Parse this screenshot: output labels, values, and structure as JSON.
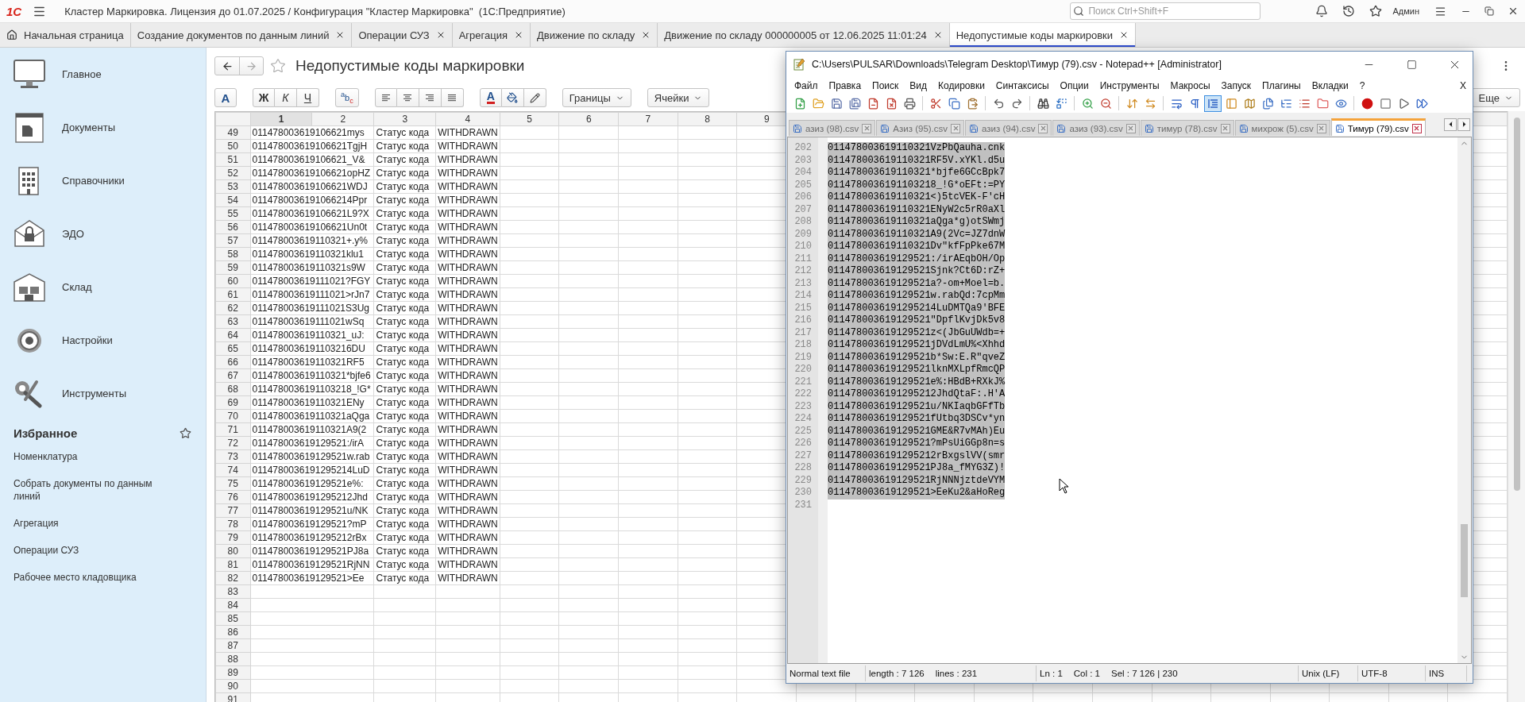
{
  "title_bar": {
    "logo": "1С",
    "title": "Кластер Маркировка. Лицензия до 01.07.2025 / Конфигурация \"Кластер Маркировка\"  (1С:Предприятие)",
    "search": {
      "placeholder": "Поиск Ctrl+Shift+F"
    },
    "user": "Админ"
  },
  "tabs": [
    {
      "label": "Начальная страница",
      "kind": "home",
      "selected": false
    },
    {
      "label": "Создание документов по данным линий",
      "kind": "form",
      "selected": false
    },
    {
      "label": "Операции СУЗ",
      "kind": "form",
      "selected": false
    },
    {
      "label": "Агрегация",
      "kind": "form",
      "selected": false
    },
    {
      "label": "Движение по складу",
      "kind": "form",
      "selected": false
    },
    {
      "label": "Движение по складу 000000005 от 12.06.2025 11:01:24",
      "kind": "form",
      "selected": false
    },
    {
      "label": "Недопустимые коды маркировки",
      "kind": "form",
      "selected": true
    }
  ],
  "sidebar": {
    "sections": [
      "Главное",
      "Документы",
      "Справочники",
      "ЭДО",
      "Склад",
      "Настройки",
      "Инструменты"
    ],
    "favorites": {
      "title": "Избранное",
      "items": [
        "Номенклатура",
        "Собрать документы по данным линий",
        "Агрегация",
        "Операции СУЗ",
        "Рабочее место кладовщика"
      ]
    }
  },
  "form": {
    "title": "Недопустимые коды маркировки",
    "toolbar": {
      "font": "A",
      "bold": "Ж",
      "italic": "К",
      "underline": "Ч",
      "spell": "$^{a}$b$_{c}$",
      "text_color": "A",
      "borders": "Границы",
      "cells": "Ячейки",
      "more": "Еще"
    }
  },
  "sheet": {
    "columns": [
      {
        "label": "1",
        "selected": true
      },
      {
        "label": "2",
        "selected": false
      },
      {
        "label": "3",
        "selected": false
      },
      {
        "label": "4",
        "selected": false
      },
      {
        "label": "5",
        "selected": false
      },
      {
        "label": "6",
        "selected": false
      },
      {
        "label": "7",
        "selected": false
      },
      {
        "label": "8",
        "selected": false
      },
      {
        "label": "9",
        "selected": false
      }
    ],
    "rows": [
      {
        "num": "49",
        "cells": [
          "011478003619106621mys",
          "Статус кода",
          "WITHDRAWN"
        ]
      },
      {
        "num": "50",
        "cells": [
          "011478003619106621TgjH",
          "Статус кода",
          "WITHDRAWN"
        ]
      },
      {
        "num": "51",
        "cells": [
          "011478003619106621_V&",
          "Статус кода",
          "WITHDRAWN"
        ]
      },
      {
        "num": "52",
        "cells": [
          "011478003619106621opHZ",
          "Статус кода",
          "WITHDRAWN"
        ]
      },
      {
        "num": "53",
        "cells": [
          "011478003619106621WDJ",
          "Статус кода",
          "WITHDRAWN"
        ]
      },
      {
        "num": "54",
        "cells": [
          "0114780036191066214Ppr",
          "Статус кода",
          "WITHDRAWN"
        ]
      },
      {
        "num": "55",
        "cells": [
          "011478003619106621L9?X",
          "Статус кода",
          "WITHDRAWN"
        ]
      },
      {
        "num": "56",
        "cells": [
          "011478003619106621Un0t",
          "Статус кода",
          "WITHDRAWN"
        ]
      },
      {
        "num": "57",
        "cells": [
          "011478003619110321+.y%",
          "Статус кода",
          "WITHDRAWN"
        ]
      },
      {
        "num": "58",
        "cells": [
          "011478003619110321klu1",
          "Статус кода",
          "WITHDRAWN"
        ]
      },
      {
        "num": "59",
        "cells": [
          "011478003619110321s9W",
          "Статус кода",
          "WITHDRAWN"
        ]
      },
      {
        "num": "60",
        "cells": [
          "011478003619111021?FGY",
          "Статус кода",
          "WITHDRAWN"
        ]
      },
      {
        "num": "61",
        "cells": [
          "011478003619111021>rJn7",
          "Статус кода",
          "WITHDRAWN"
        ]
      },
      {
        "num": "62",
        "cells": [
          "011478003619111021S3Ug",
          "Статус кода",
          "WITHDRAWN"
        ]
      },
      {
        "num": "63",
        "cells": [
          "011478003619111021wSq",
          "Статус кода",
          "WITHDRAWN"
        ]
      },
      {
        "num": "64",
        "cells": [
          "011478003619110321_uJ:",
          "Статус кода",
          "WITHDRAWN"
        ]
      },
      {
        "num": "65",
        "cells": [
          "0114780036191103216DU",
          "Статус кода",
          "WITHDRAWN"
        ]
      },
      {
        "num": "66",
        "cells": [
          "011478003619110321RF5",
          "Статус кода",
          "WITHDRAWN"
        ]
      },
      {
        "num": "67",
        "cells": [
          "011478003619110321*bjfe6",
          "Статус кода",
          "WITHDRAWN"
        ]
      },
      {
        "num": "68",
        "cells": [
          "0114780036191103218_!G*",
          "Статус кода",
          "WITHDRAWN"
        ]
      },
      {
        "num": "69",
        "cells": [
          "011478003619110321ENy",
          "Статус кода",
          "WITHDRAWN"
        ]
      },
      {
        "num": "70",
        "cells": [
          "011478003619110321aQga",
          "Статус кода",
          "WITHDRAWN"
        ]
      },
      {
        "num": "71",
        "cells": [
          "011478003619110321A9(2",
          "Статус кода",
          "WITHDRAWN"
        ]
      },
      {
        "num": "72",
        "cells": [
          "011478003619129521:/irA",
          "Статус кода",
          "WITHDRAWN"
        ]
      },
      {
        "num": "73",
        "cells": [
          "011478003619129521w.rab",
          "Статус кода",
          "WITHDRAWN"
        ]
      },
      {
        "num": "74",
        "cells": [
          "0114780036191295214LuD",
          "Статус кода",
          "WITHDRAWN"
        ]
      },
      {
        "num": "75",
        "cells": [
          "011478003619129521e%:",
          "Статус кода",
          "WITHDRAWN"
        ]
      },
      {
        "num": "76",
        "cells": [
          "0114780036191295212Jhd",
          "Статус кода",
          "WITHDRAWN"
        ]
      },
      {
        "num": "77",
        "cells": [
          "011478003619129521u/NK",
          "Статус кода",
          "WITHDRAWN"
        ]
      },
      {
        "num": "78",
        "cells": [
          "011478003619129521?mP",
          "Статус кода",
          "WITHDRAWN"
        ]
      },
      {
        "num": "79",
        "cells": [
          "0114780036191295212rBx",
          "Статус кода",
          "WITHDRAWN"
        ]
      },
      {
        "num": "80",
        "cells": [
          "011478003619129521PJ8a",
          "Статус кода",
          "WITHDRAWN"
        ]
      },
      {
        "num": "81",
        "cells": [
          "011478003619129521RjNN",
          "Статус кода",
          "WITHDRAWN"
        ]
      },
      {
        "num": "82",
        "cells": [
          "011478003619129521>Ee",
          "Статус кода",
          "WITHDRAWN"
        ]
      },
      {
        "num": "83"
      },
      {
        "num": "84"
      },
      {
        "num": "85"
      },
      {
        "num": "86"
      },
      {
        "num": "87"
      },
      {
        "num": "88"
      },
      {
        "num": "89"
      },
      {
        "num": "90"
      },
      {
        "num": "91"
      }
    ]
  },
  "notepad": {
    "title": "C:\\Users\\PULSAR\\Downloads\\Telegram Desktop\\Тимур (79).csv - Notepad++ [Administrator]",
    "menu": [
      "Файл",
      "Правка",
      "Поиск",
      "Вид",
      "Кодировки",
      "Синтаксисы",
      "Опции",
      "Инструменты",
      "Макросы",
      "Запуск",
      "Плагины",
      "Вкладки",
      "?"
    ],
    "menu_close": "X",
    "toolbar": [
      {
        "on": false
      },
      {
        "on": false
      },
      {
        "on": false
      },
      {
        "on": false
      },
      {
        "on": false
      },
      {
        "on": false
      },
      {
        "on": false
      },
      {
        "on": false
      },
      {
        "on": false
      },
      {
        "on": false
      },
      {
        "on": false
      },
      {
        "on": false
      },
      {
        "on": false
      },
      {
        "on": false
      },
      {
        "on": false
      },
      {
        "on": false
      },
      {
        "on": false
      },
      {
        "on": false
      },
      {
        "on": false
      },
      {
        "on": false
      },
      {
        "on": true
      },
      {
        "on": false
      },
      {
        "on": false
      },
      {
        "on": false
      },
      {
        "on": false
      },
      {
        "on": false
      },
      {
        "on": false
      },
      {
        "on": false
      },
      {
        "on": false
      },
      {
        "on": false
      },
      {
        "on": false
      },
      {
        "on": false
      }
    ],
    "tabs": [
      {
        "label": "азиз (98).csv",
        "selected": false
      },
      {
        "label": "Азиз (95).csv",
        "selected": false
      },
      {
        "label": "азиз (94).csv",
        "selected": false
      },
      {
        "label": "азиз (93).csv",
        "selected": false
      },
      {
        "label": "тимур (78).csv",
        "selected": false
      },
      {
        "label": "михрож (5).csv",
        "selected": false
      },
      {
        "label": "Тимур (79).csv",
        "selected": true
      }
    ],
    "lines": [
      {
        "num": "202",
        "text": "011478003619110321VzPbQauha.cnk",
        "selected": true
      },
      {
        "num": "203",
        "text": "011478003619110321RF5V.xYKl.d5u",
        "selected": true
      },
      {
        "num": "204",
        "text": "011478003619110321*bjfe6GCcBpk7",
        "selected": true
      },
      {
        "num": "205",
        "text": "0114780036191103218_!G*oEFt:=PY",
        "selected": true
      },
      {
        "num": "206",
        "text": "011478003619110321<)5tcVEK-F'cH",
        "selected": true
      },
      {
        "num": "207",
        "text": "011478003619110321ENyW2c5rR0aXl",
        "selected": true
      },
      {
        "num": "208",
        "text": "011478003619110321aQga*g)otSWmj",
        "selected": true
      },
      {
        "num": "209",
        "text": "011478003619110321A9(2Vc=JZ7dnW",
        "selected": true
      },
      {
        "num": "210",
        "text": "011478003619110321Dv\"kfFpPke67M",
        "selected": true
      },
      {
        "num": "211",
        "text": "011478003619129521:/irAEqbOH/Op",
        "selected": true
      },
      {
        "num": "212",
        "text": "011478003619129521Sjnk?Ct6D:rZ+",
        "selected": true
      },
      {
        "num": "213",
        "text": "011478003619129521a?-om+Moel=b.",
        "selected": true
      },
      {
        "num": "214",
        "text": "011478003619129521w.rabQd:7cpMm",
        "selected": true
      },
      {
        "num": "215",
        "text": "0114780036191295214LuDMTQa9'BFE",
        "selected": true
      },
      {
        "num": "216",
        "text": "011478003619129521\"DpflKvjDk5v8",
        "selected": true
      },
      {
        "num": "217",
        "text": "011478003619129521z<(JbGuUWdb=+",
        "selected": true
      },
      {
        "num": "218",
        "text": "011478003619129521jDVdLmU%<Xhhd",
        "selected": true
      },
      {
        "num": "219",
        "text": "011478003619129521b*Sw:E.R\"qveZ",
        "selected": true
      },
      {
        "num": "220",
        "text": "011478003619129521lknMXLpfRmcQP",
        "selected": true
      },
      {
        "num": "221",
        "text": "011478003619129521e%:HBdB+RXkJ%",
        "selected": true
      },
      {
        "num": "222",
        "text": "0114780036191295212JhdQtaF:.H'A",
        "selected": true
      },
      {
        "num": "223",
        "text": "011478003619129521u/NKIaqbGFfTb",
        "selected": true
      },
      {
        "num": "224",
        "text": "011478003619129521fUtbq3DSCv*yn",
        "selected": true
      },
      {
        "num": "225",
        "text": "011478003619129521GME&R7vMAh)Eu",
        "selected": true
      },
      {
        "num": "226",
        "text": "011478003619129521?mPsUiGGp8n=s",
        "selected": true
      },
      {
        "num": "227",
        "text": "0114780036191295212rBxgslVV(smr",
        "selected": true
      },
      {
        "num": "228",
        "text": "011478003619129521PJ8a_fMYG3Z)!",
        "selected": true
      },
      {
        "num": "229",
        "text": "011478003619129521RjNNNjztdeVYM",
        "selected": true
      },
      {
        "num": "230",
        "text": "011478003619129521>EeKu2&aHoReg",
        "selected": true
      },
      {
        "num": "231",
        "selected": false
      }
    ],
    "status": [
      {
        "items": [
          "Normal text file"
        ]
      },
      {
        "items": [
          "length : 7 126",
          "lines : 231"
        ]
      },
      {
        "items": [
          "Ln : 1",
          "Col : 1",
          "Sel : 7 126 | 230"
        ]
      },
      {
        "items": [
          "Unix (LF)"
        ]
      },
      {
        "items": [
          "UTF-8"
        ]
      },
      {
        "items": [
          "INS"
        ]
      }
    ]
  }
}
